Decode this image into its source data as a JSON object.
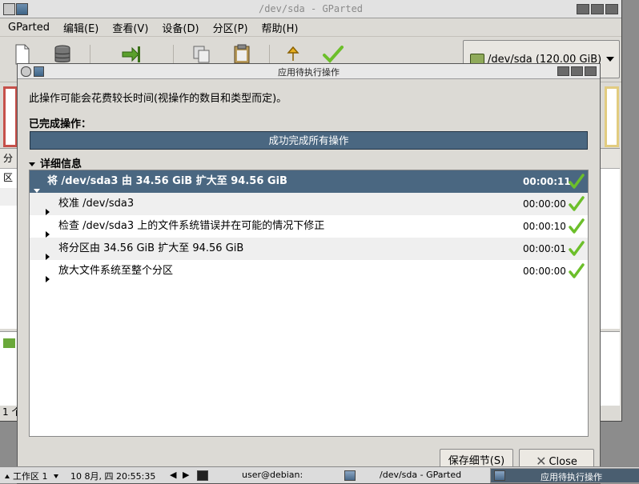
{
  "main_window": {
    "title": "/dev/sda - GParted",
    "menus": [
      "GParted",
      "编辑(E)",
      "查看(V)",
      "设备(D)",
      "分区(P)",
      "帮助(H)"
    ],
    "toolbar_partial_label": "新",
    "device_combo": "/dev/sda  (120.00 GiB)",
    "partial_list_header": "分区",
    "partial_status": "1 个"
  },
  "dialog": {
    "title": "应用待执行操作",
    "description": "此操作可能会花费较长时间(视操作的数目和类型而定)。",
    "completed_label": "已完成操作：",
    "progress_text": "成功完成所有操作",
    "details_label": "详细信息",
    "operations": [
      {
        "text": "将 /dev/sda3 由 34.56 GiB 扩大至 94.56 GiB",
        "time": "00:00:11",
        "expanded": true,
        "selected": true
      },
      {
        "text": "校准 /dev/sda3",
        "time": "00:00:00"
      },
      {
        "text": "检查 /dev/sda3 上的文件系统错误并在可能的情况下修正",
        "time": "00:00:10"
      },
      {
        "text": "将分区由 34.56 GiB 扩大至 94.56 GiB",
        "time": "00:00:01"
      },
      {
        "text": "放大文件系统至整个分区",
        "time": "00:00:00"
      }
    ],
    "buttons": {
      "save": "保存细节(S)",
      "close": "Close"
    }
  },
  "taskbar": {
    "workspace": "工作区 1",
    "clock": "10 8月, 四 20:55:35",
    "terminal": "user@debian:",
    "gparted_task": "/dev/sda - GParted",
    "dialog_task": "应用待执行操作"
  },
  "colors": {
    "selection": "#4a6781",
    "check": "#6cbf2a"
  }
}
